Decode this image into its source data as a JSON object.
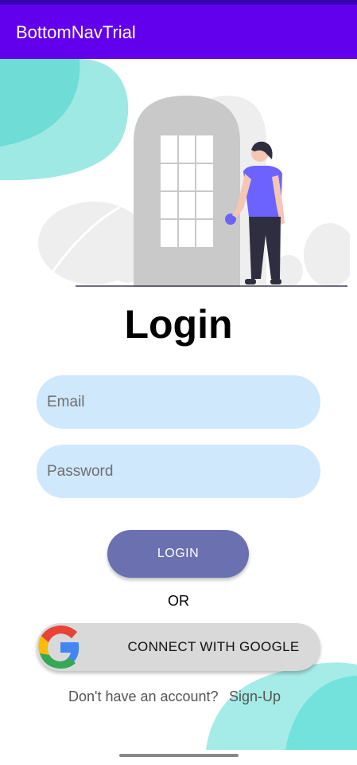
{
  "app_bar": {
    "title": "BottomNavTrial"
  },
  "login": {
    "heading": "Login",
    "email_placeholder": "Email",
    "password_placeholder": "Password",
    "login_button": "LOGIN",
    "or_text": "OR",
    "google_button": "CONNECT WITH GOOGLE",
    "signup_prompt": "Don't have an account?",
    "signup_link": "Sign-Up"
  },
  "colors": {
    "app_bar": "#6200ee",
    "status_bar": "#3700b3",
    "field_bg": "#cfe8fc",
    "login_button": "#6a70b0",
    "google_button": "#d9d9d9",
    "blob": "#7fe3df",
    "figure_shirt": "#6c63ff"
  },
  "icons": {
    "google": "google-logo-icon",
    "illustration": "door-person-illustration"
  }
}
